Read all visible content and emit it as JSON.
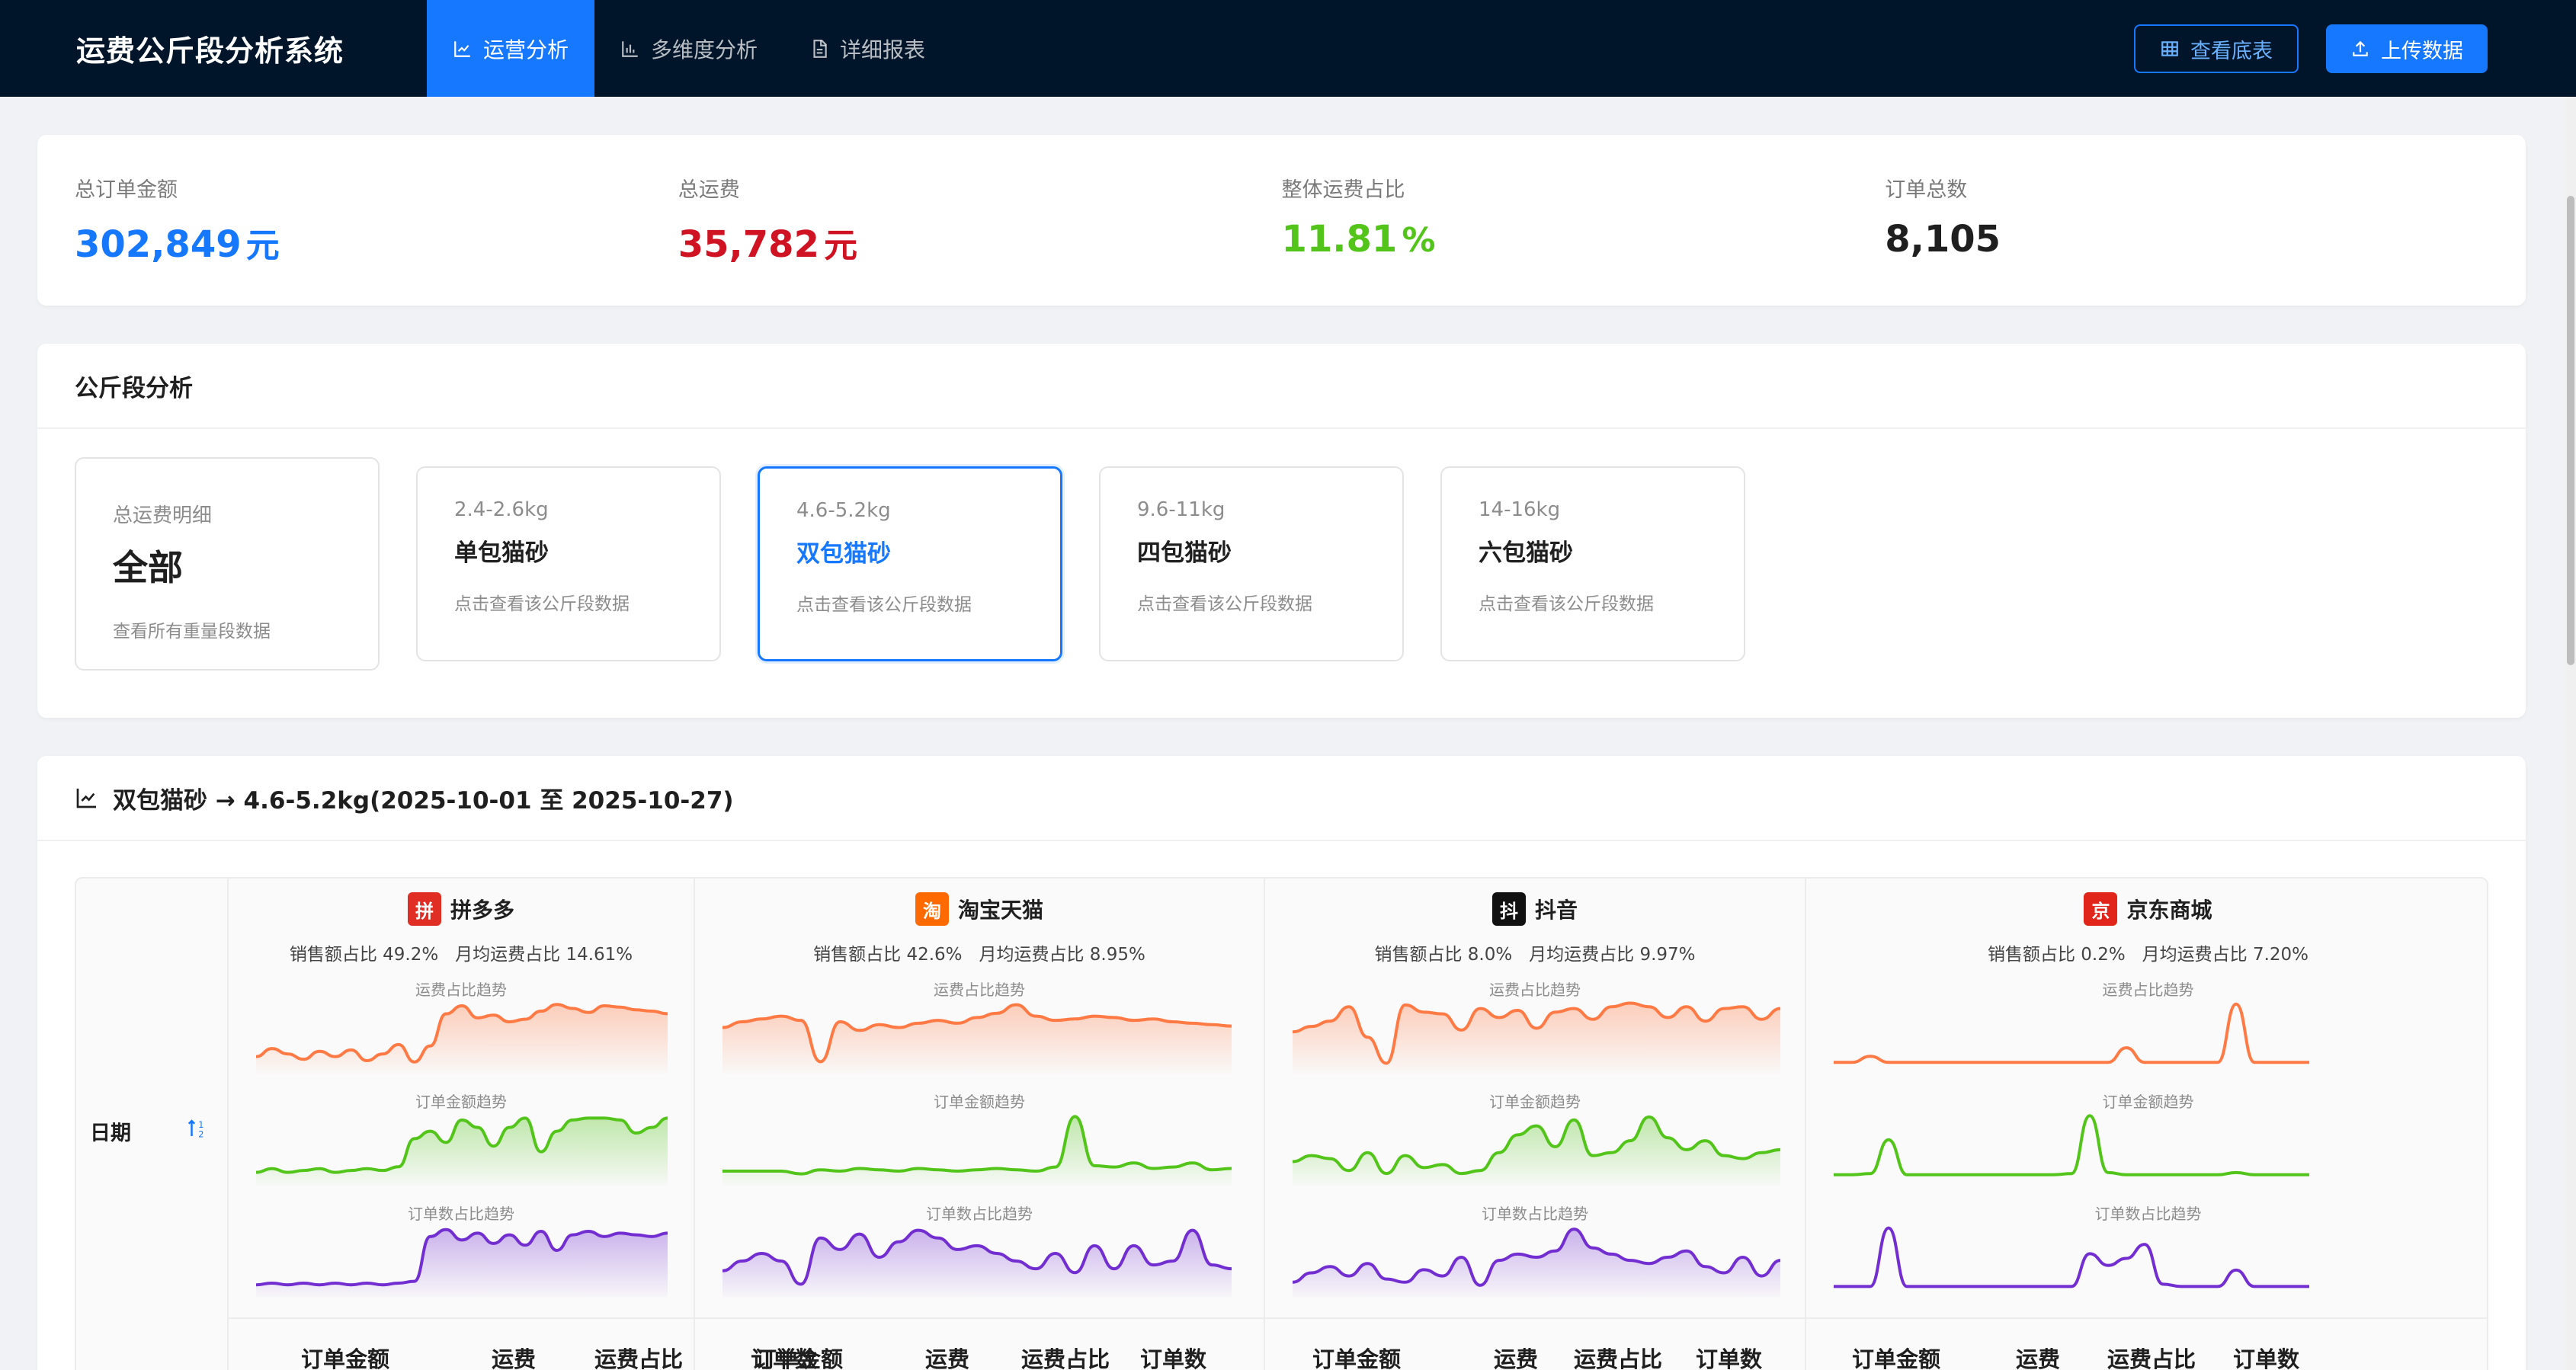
{
  "app": {
    "title": "运费公斤段分析系统",
    "nav": [
      {
        "label": "运营分析",
        "icon": "line-chart-icon",
        "active": true
      },
      {
        "label": "多维度分析",
        "icon": "bar-chart-icon",
        "active": false
      },
      {
        "label": "详细报表",
        "icon": "file-text-icon",
        "active": false
      }
    ],
    "actions": {
      "view_table": "查看底表",
      "upload": "上传数据"
    }
  },
  "stats": [
    {
      "label": "总订单金额",
      "value": "302,849",
      "unit": "元",
      "color": "#1677ff"
    },
    {
      "label": "总运费",
      "value": "35,782",
      "unit": "元",
      "color": "#cf1322"
    },
    {
      "label": "整体运费占比",
      "value": "11.81",
      "unit": "%",
      "color": "#52c41a"
    },
    {
      "label": "订单总数",
      "value": "8,105",
      "unit": "",
      "color": "#1f1f1f"
    }
  ],
  "segments": {
    "title": "公斤段分析",
    "tiles": [
      {
        "sub": "总运费明细",
        "title": "全部",
        "hint": "查看所有重量段数据",
        "active": false
      },
      {
        "sub": "2.4-2.6kg",
        "title": "单包猫砂",
        "hint": "点击查看该公斤段数据",
        "active": false
      },
      {
        "sub": "4.6-5.2kg",
        "title": "双包猫砂",
        "hint": "点击查看该公斤段数据",
        "active": true
      },
      {
        "sub": "9.6-11kg",
        "title": "四包猫砂",
        "hint": "点击查看该公斤段数据",
        "active": false
      },
      {
        "sub": "14-16kg",
        "title": "六包猫砂",
        "hint": "点击查看该公斤段数据",
        "active": false
      }
    ]
  },
  "detail": {
    "title": "双包猫砂 → 4.6-5.2kg(2025-10-01 至 2025-10-27)",
    "date_label": "日期",
    "trend_labels": {
      "fee": "运费占比趋势",
      "amount": "订单金额趋势",
      "count": "订单数占比趋势"
    },
    "col_heads": [
      "订单金额",
      "运费",
      "运费占比",
      "订单数"
    ],
    "colors": {
      "fee": "#ff7a45",
      "amount": "#52c41a",
      "count": "#722ed1"
    },
    "platforms": [
      {
        "name": "拼多多",
        "logo": "拼",
        "logo_color": "#e02e24",
        "meta": "销售额占比 49.2%   月均运费占比 14.61%",
        "fee": [
          3,
          3.6,
          3.2,
          2.8,
          3.4,
          3.0,
          3.5,
          2.7,
          3.2,
          3.9,
          2.6,
          3.8,
          6.2,
          6.8,
          5.9,
          6.1,
          5.6,
          5.8,
          6.4,
          6.9,
          6.6,
          6.3,
          6.8,
          6.7,
          6.5,
          6.4,
          6.2
        ],
        "amount": [
          1,
          1.2,
          1.0,
          1.1,
          1.2,
          1.0,
          1.1,
          1.2,
          1.1,
          1.3,
          2.8,
          3.2,
          2.6,
          3.8,
          3.4,
          2.4,
          3.4,
          3.9,
          2.1,
          3.2,
          3.8,
          3.9,
          3.9,
          3.8,
          3.1,
          3.4,
          3.9
        ],
        "count": [
          1,
          1.1,
          1.0,
          1.1,
          1.0,
          1.1,
          1.0,
          1.1,
          1.0,
          1.1,
          1.2,
          3.8,
          4.2,
          3.6,
          4.0,
          3.4,
          3.9,
          3.3,
          4.1,
          3.0,
          3.9,
          4.1,
          3.8,
          4.0,
          3.9,
          3.8,
          4.0
        ]
      },
      {
        "name": "淘宝天猫",
        "logo": "淘",
        "logo_color": "#ff6a00",
        "meta": "销售额占比 42.6%   月均运费占比 8.95%",
        "fee": [
          4,
          4.4,
          4.6,
          4.8,
          4.5,
          1.6,
          4.4,
          3.8,
          4.2,
          4.0,
          4.3,
          4.5,
          4.3,
          4.7,
          5.0,
          5.6,
          4.8,
          4.5,
          4.6,
          4.8,
          4.7,
          4.5,
          4.6,
          4.4,
          4.3,
          4.2,
          4.1
        ],
        "amount": [
          1,
          1.0,
          1.0,
          1.0,
          0.8,
          1.1,
          1.0,
          1.2,
          1.1,
          1.0,
          1.2,
          1.1,
          1.0,
          1.1,
          1.2,
          1.1,
          1.0,
          1.3,
          5.0,
          1.4,
          1.3,
          1.6,
          1.2,
          1.3,
          1.6,
          1.1,
          1.2
        ],
        "count": [
          1.5,
          2.0,
          2.4,
          2.0,
          0.8,
          3.2,
          2.6,
          3.4,
          2.2,
          3.0,
          3.6,
          3.2,
          2.6,
          2.8,
          2.4,
          2.0,
          1.6,
          2.4,
          1.4,
          2.8,
          1.6,
          2.8,
          1.8,
          2.0,
          3.6,
          1.8,
          1.6
        ]
      },
      {
        "name": "抖音",
        "logo": "抖",
        "logo_color": "#111111",
        "meta": "销售额占比 8.0%   月均运费占比 9.97%",
        "fee": [
          3,
          3.6,
          4.2,
          5.8,
          2.4,
          -0.5,
          6.0,
          5.2,
          5.0,
          3.2,
          5.6,
          4.6,
          5.4,
          3.4,
          5.2,
          5.6,
          4.4,
          5.8,
          6.2,
          5.8,
          4.6,
          5.8,
          4.2,
          5.6,
          5.8,
          4.4,
          5.6
        ],
        "amount": [
          2,
          2.4,
          2.2,
          1.4,
          2.6,
          1.2,
          2.4,
          1.6,
          1.8,
          1.2,
          1.4,
          2.6,
          3.8,
          4.4,
          3.0,
          4.8,
          2.4,
          2.6,
          3.4,
          5.0,
          3.6,
          2.8,
          3.4,
          2.4,
          2.2,
          2.6,
          2.8
        ],
        "count": [
          1.2,
          1.8,
          2.2,
          1.6,
          2.4,
          1.4,
          1.2,
          2.0,
          1.6,
          2.8,
          1.0,
          2.6,
          3.0,
          2.8,
          3.2,
          4.6,
          3.4,
          3.0,
          2.6,
          2.4,
          2.8,
          3.2,
          2.2,
          1.8,
          2.8,
          1.6,
          2.6
        ],
        "fill": true
      },
      {
        "name": "京东商城",
        "logo": "京",
        "logo_color": "#e1251b",
        "meta": "销售额占比 0.2%   月均运费占比 7.20%",
        "fee": [
          0.4,
          0.4,
          0.9,
          0.4,
          0.4,
          0.4,
          0.4,
          0.4,
          0.4,
          0.4,
          0.4,
          0.4,
          0.4,
          0.4,
          0.4,
          0.4,
          1.6,
          0.4,
          0.4,
          0.4,
          0.4,
          0.4,
          5.2,
          0.4,
          0.4,
          0.4,
          0.4
        ],
        "amount": [
          0.2,
          0.2,
          0.3,
          3.4,
          0.2,
          0.2,
          0.2,
          0.2,
          0.2,
          0.2,
          0.2,
          0.2,
          0.2,
          0.3,
          5.6,
          0.4,
          0.2,
          0.2,
          0.2,
          0.2,
          0.2,
          0.2,
          0.4,
          0.2,
          0.2,
          0.2,
          0.2
        ],
        "count": [
          0.2,
          0.2,
          0.2,
          5.2,
          0.2,
          0.2,
          0.2,
          0.2,
          0.2,
          0.2,
          0.2,
          0.2,
          0.2,
          0.2,
          3.0,
          2.0,
          2.6,
          3.8,
          0.4,
          0.2,
          0.2,
          0.2,
          1.6,
          0.2,
          0.2,
          0.2,
          0.2
        ]
      }
    ]
  }
}
